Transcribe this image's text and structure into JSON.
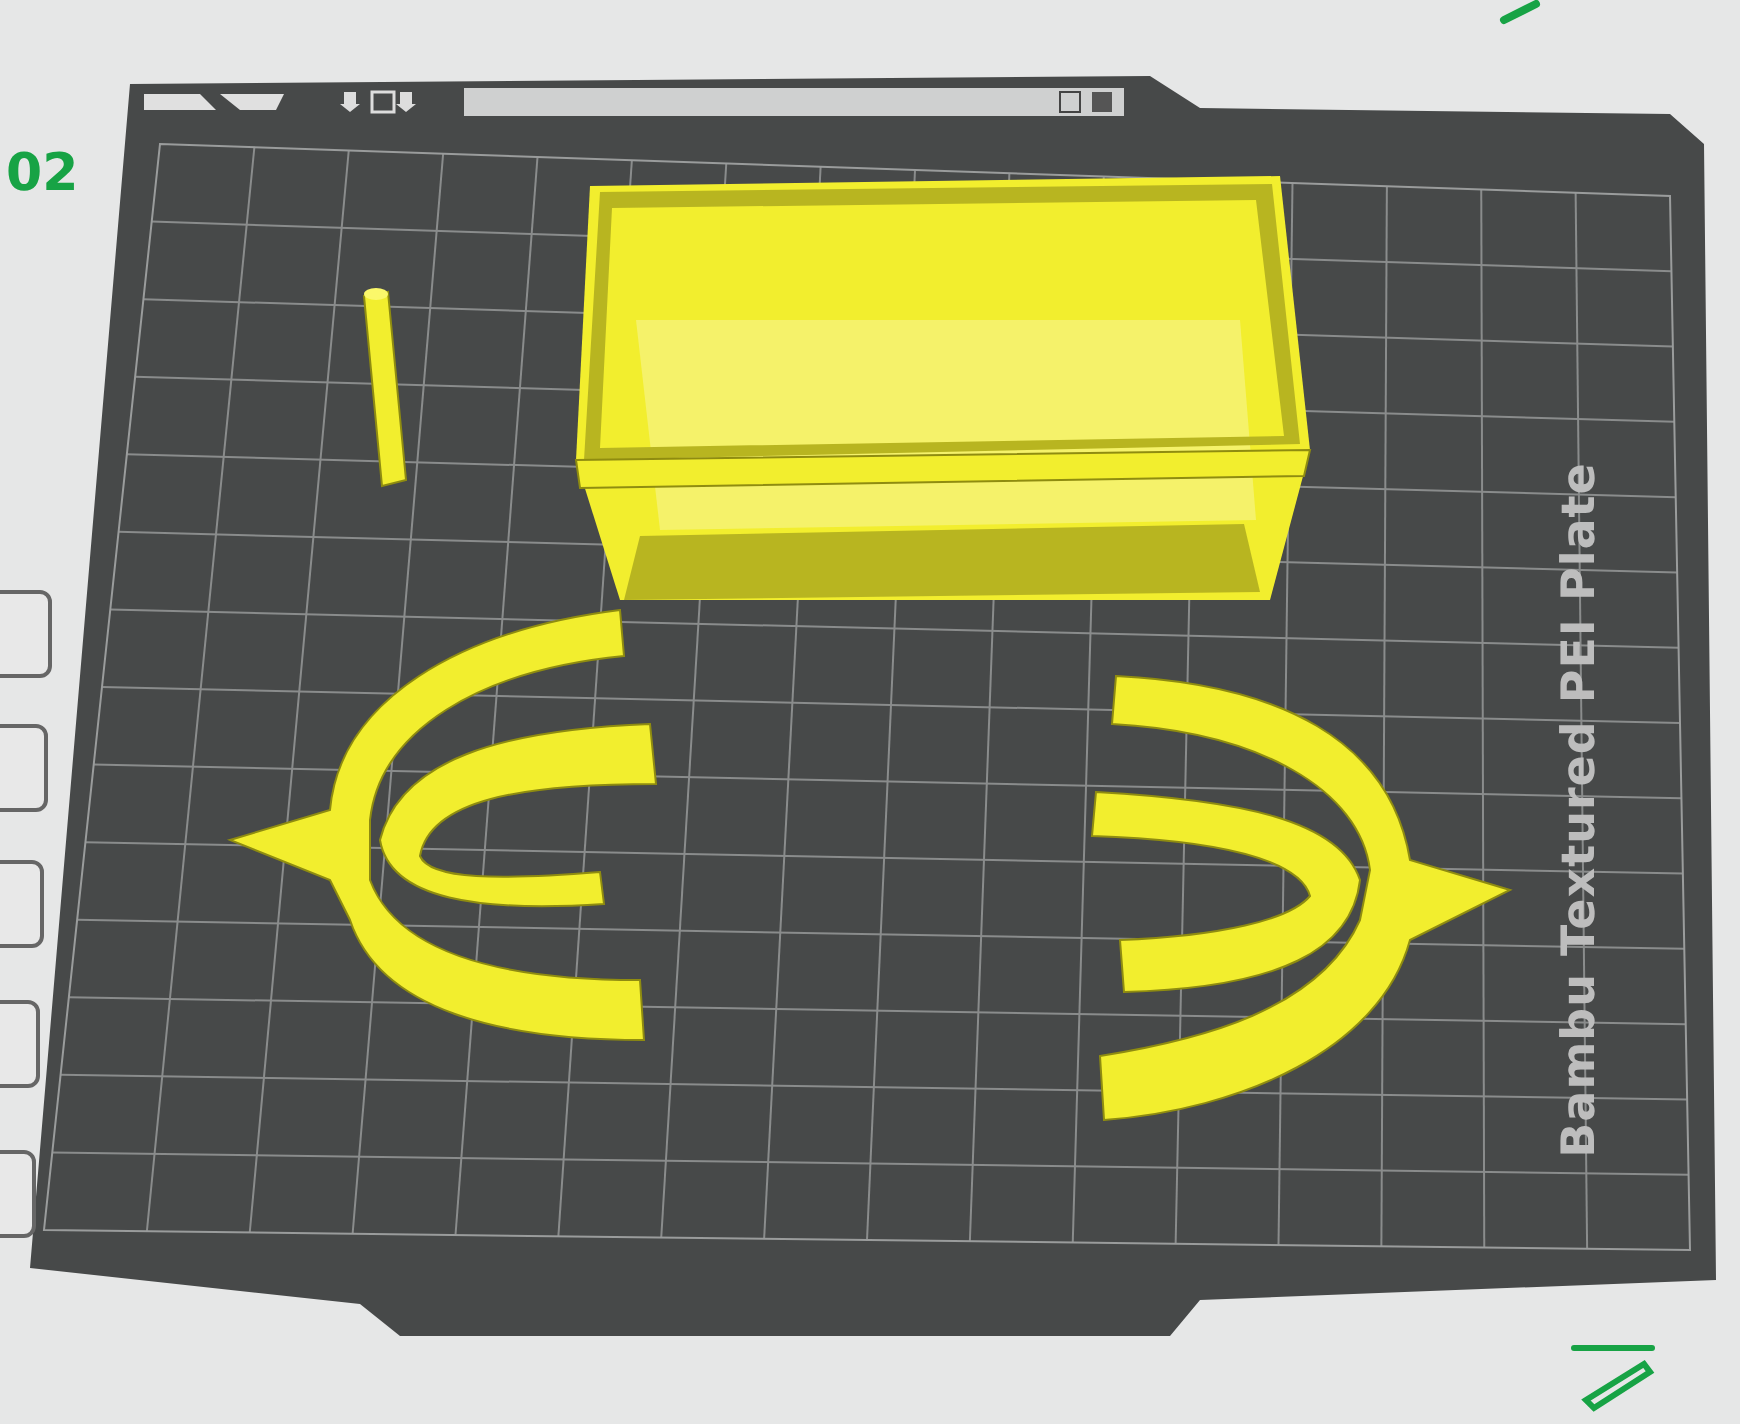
{
  "plate": {
    "label": "Bambu Textured PEI Plate",
    "number": "02"
  }
}
